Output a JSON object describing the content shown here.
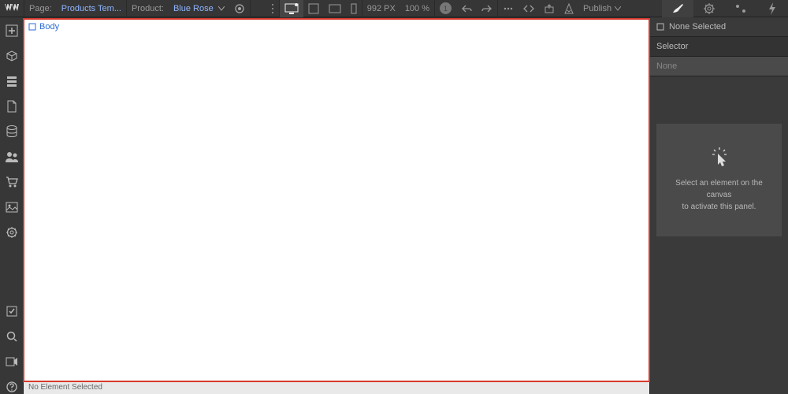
{
  "topbar": {
    "page_label": "Page:",
    "page_name": "Products Tem...",
    "product_label": "Product:",
    "product_name": "Blue Rose",
    "width_value": "992",
    "width_unit": "PX",
    "zoom": "100 %",
    "issues_count": "1",
    "publish_label": "Publish"
  },
  "canvas": {
    "body_label": "Body"
  },
  "statusbar": {
    "text": "No Element Selected"
  },
  "right": {
    "none_selected": "None Selected",
    "selector_label": "Selector",
    "selector_value": "None",
    "empty_msg_line1": "Select an element on the canvas",
    "empty_msg_line2": "to activate this panel."
  }
}
